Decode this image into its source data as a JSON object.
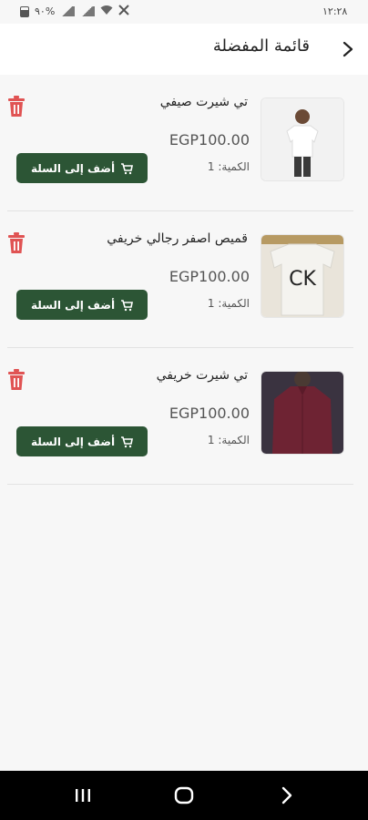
{
  "status_bar": {
    "time": "١٢:٢٨",
    "battery": "٩٠%"
  },
  "header": {
    "title": "قائمة المفضلة"
  },
  "items": [
    {
      "name": "تي شيرت صيفي",
      "price": "EGP100.00",
      "quantity": "الكمية: 1",
      "button_label": "أضف إلى السلة"
    },
    {
      "name": "قميص اصفر رجالي خريفي",
      "price": "EGP100.00",
      "quantity": "الكمية: 1",
      "button_label": "أضف إلى السلة"
    },
    {
      "name": "تي شيرت خريفي",
      "price": "EGP100.00",
      "quantity": "الكمية: 1",
      "button_label": "أضف إلى السلة"
    }
  ],
  "colors": {
    "accent": "#2c5535",
    "delete": "#e05353"
  }
}
